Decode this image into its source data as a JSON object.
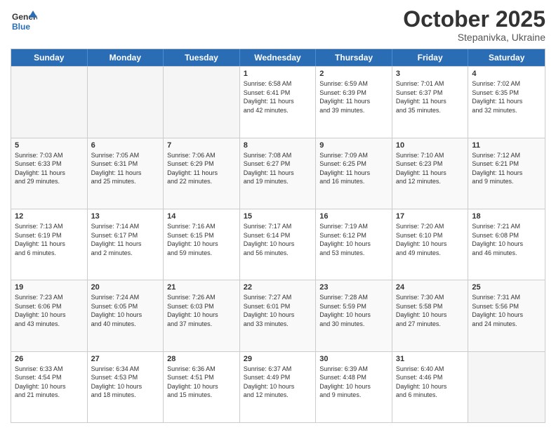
{
  "header": {
    "logo_general": "General",
    "logo_blue": "Blue",
    "month": "October 2025",
    "location": "Stepanivka, Ukraine"
  },
  "weekdays": [
    "Sunday",
    "Monday",
    "Tuesday",
    "Wednesday",
    "Thursday",
    "Friday",
    "Saturday"
  ],
  "weeks": [
    [
      {
        "day": "",
        "info": "",
        "empty": true
      },
      {
        "day": "",
        "info": "",
        "empty": true
      },
      {
        "day": "",
        "info": "",
        "empty": true
      },
      {
        "day": "1",
        "info": "Sunrise: 6:58 AM\nSunset: 6:41 PM\nDaylight: 11 hours\nand 42 minutes."
      },
      {
        "day": "2",
        "info": "Sunrise: 6:59 AM\nSunset: 6:39 PM\nDaylight: 11 hours\nand 39 minutes."
      },
      {
        "day": "3",
        "info": "Sunrise: 7:01 AM\nSunset: 6:37 PM\nDaylight: 11 hours\nand 35 minutes."
      },
      {
        "day": "4",
        "info": "Sunrise: 7:02 AM\nSunset: 6:35 PM\nDaylight: 11 hours\nand 32 minutes."
      }
    ],
    [
      {
        "day": "5",
        "info": "Sunrise: 7:03 AM\nSunset: 6:33 PM\nDaylight: 11 hours\nand 29 minutes."
      },
      {
        "day": "6",
        "info": "Sunrise: 7:05 AM\nSunset: 6:31 PM\nDaylight: 11 hours\nand 25 minutes."
      },
      {
        "day": "7",
        "info": "Sunrise: 7:06 AM\nSunset: 6:29 PM\nDaylight: 11 hours\nand 22 minutes."
      },
      {
        "day": "8",
        "info": "Sunrise: 7:08 AM\nSunset: 6:27 PM\nDaylight: 11 hours\nand 19 minutes."
      },
      {
        "day": "9",
        "info": "Sunrise: 7:09 AM\nSunset: 6:25 PM\nDaylight: 11 hours\nand 16 minutes."
      },
      {
        "day": "10",
        "info": "Sunrise: 7:10 AM\nSunset: 6:23 PM\nDaylight: 11 hours\nand 12 minutes."
      },
      {
        "day": "11",
        "info": "Sunrise: 7:12 AM\nSunset: 6:21 PM\nDaylight: 11 hours\nand 9 minutes."
      }
    ],
    [
      {
        "day": "12",
        "info": "Sunrise: 7:13 AM\nSunset: 6:19 PM\nDaylight: 11 hours\nand 6 minutes."
      },
      {
        "day": "13",
        "info": "Sunrise: 7:14 AM\nSunset: 6:17 PM\nDaylight: 11 hours\nand 2 minutes."
      },
      {
        "day": "14",
        "info": "Sunrise: 7:16 AM\nSunset: 6:15 PM\nDaylight: 10 hours\nand 59 minutes."
      },
      {
        "day": "15",
        "info": "Sunrise: 7:17 AM\nSunset: 6:14 PM\nDaylight: 10 hours\nand 56 minutes."
      },
      {
        "day": "16",
        "info": "Sunrise: 7:19 AM\nSunset: 6:12 PM\nDaylight: 10 hours\nand 53 minutes."
      },
      {
        "day": "17",
        "info": "Sunrise: 7:20 AM\nSunset: 6:10 PM\nDaylight: 10 hours\nand 49 minutes."
      },
      {
        "day": "18",
        "info": "Sunrise: 7:21 AM\nSunset: 6:08 PM\nDaylight: 10 hours\nand 46 minutes."
      }
    ],
    [
      {
        "day": "19",
        "info": "Sunrise: 7:23 AM\nSunset: 6:06 PM\nDaylight: 10 hours\nand 43 minutes."
      },
      {
        "day": "20",
        "info": "Sunrise: 7:24 AM\nSunset: 6:05 PM\nDaylight: 10 hours\nand 40 minutes."
      },
      {
        "day": "21",
        "info": "Sunrise: 7:26 AM\nSunset: 6:03 PM\nDaylight: 10 hours\nand 37 minutes."
      },
      {
        "day": "22",
        "info": "Sunrise: 7:27 AM\nSunset: 6:01 PM\nDaylight: 10 hours\nand 33 minutes."
      },
      {
        "day": "23",
        "info": "Sunrise: 7:28 AM\nSunset: 5:59 PM\nDaylight: 10 hours\nand 30 minutes."
      },
      {
        "day": "24",
        "info": "Sunrise: 7:30 AM\nSunset: 5:58 PM\nDaylight: 10 hours\nand 27 minutes."
      },
      {
        "day": "25",
        "info": "Sunrise: 7:31 AM\nSunset: 5:56 PM\nDaylight: 10 hours\nand 24 minutes."
      }
    ],
    [
      {
        "day": "26",
        "info": "Sunrise: 6:33 AM\nSunset: 4:54 PM\nDaylight: 10 hours\nand 21 minutes."
      },
      {
        "day": "27",
        "info": "Sunrise: 6:34 AM\nSunset: 4:53 PM\nDaylight: 10 hours\nand 18 minutes."
      },
      {
        "day": "28",
        "info": "Sunrise: 6:36 AM\nSunset: 4:51 PM\nDaylight: 10 hours\nand 15 minutes."
      },
      {
        "day": "29",
        "info": "Sunrise: 6:37 AM\nSunset: 4:49 PM\nDaylight: 10 hours\nand 12 minutes."
      },
      {
        "day": "30",
        "info": "Sunrise: 6:39 AM\nSunset: 4:48 PM\nDaylight: 10 hours\nand 9 minutes."
      },
      {
        "day": "31",
        "info": "Sunrise: 6:40 AM\nSunset: 4:46 PM\nDaylight: 10 hours\nand 6 minutes."
      },
      {
        "day": "",
        "info": "",
        "empty": true
      }
    ]
  ]
}
